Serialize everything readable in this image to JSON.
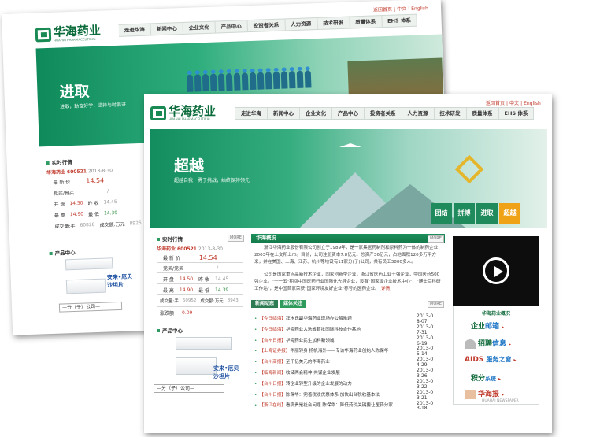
{
  "logo": {
    "name": "华海药业",
    "sub": "HUAHAI PHARMACEUTICAL"
  },
  "toplinks": [
    "返回首页",
    "中文",
    "English"
  ],
  "nav": [
    "走进华海",
    "新闻中心",
    "企业文化",
    "产品中心",
    "投资者关系",
    "人力资源",
    "技术研发",
    "质量体系",
    "EHS 体系"
  ],
  "back_banner": {
    "big": "进取",
    "sub": "进取，勤奋好学，坚持与时俱进"
  },
  "front_banner": {
    "big": "超越",
    "sub": "超越自我，勇于挑战，始终保持领先"
  },
  "banner_buttons": [
    {
      "label": "团结",
      "active": false
    },
    {
      "label": "拼搏",
      "active": false
    },
    {
      "label": "进取",
      "active": false
    },
    {
      "label": "超越",
      "active": true
    }
  ],
  "stock": {
    "title": "实时行情",
    "name": "华海药业",
    "code": "600521",
    "date": "2013-8-30",
    "latest_label": "最 新 价",
    "latest": "14.54",
    "bid_label": "竞买/竞买",
    "bid": "-/-",
    "open_label": "开 盘",
    "open": "14.50",
    "prev_label": "昨 收",
    "prev": "14.45",
    "high_label": "最 高",
    "high": "14.90",
    "low_label": "最 低",
    "low": "14.39",
    "vol_label": "成交量:手",
    "vol": "60952",
    "amt_label": "成交额:万元",
    "amt": "8943",
    "change_label": "涨跌额",
    "change": "0.09",
    "back_vol": "60828",
    "back_amt": "8925",
    "more": "MORE"
  },
  "products": {
    "title": "产品中心",
    "label1": "安来•厄贝",
    "label2": "沙坦片",
    "select": "—分（子）公司—"
  },
  "overview": {
    "title": "华海概况",
    "more": "MORE",
    "p1": "浙江华海药业股份有限公司创立于1989年，是一家集医药制剂和原料药为一体的制药企业，2003年在上交所上市。目前，公司注册资本7.8亿元，总资产36亿元，占地面积120多万平方米，并在美国、上海、江苏、杭州等地设有11家分(子)公司，共有员工3800多人。",
    "p2": "公司是国家重点高新技术企业，国家创新型企业，浙江省医药工业十强企业，中国医药500强企业。\"十一五\"期间中国医药行业国际化先导企业，设有\"国家级企业技术中心\"、\"博士后科研工作站\"，是中国首家荣获\"国家环境友好企业\"称号的医药企业。",
    "detail": "[详情]"
  },
  "news": {
    "tabs": [
      {
        "label": "新闻动态",
        "active": false
      },
      {
        "label": "媒体关注",
        "active": true
      }
    ],
    "more": "MORE",
    "items": [
      {
        "src": "【今日临海】",
        "text": "拜水氏副华海药业现场办公解难题",
        "date": "2013-08-07"
      },
      {
        "src": "【今日临海】",
        "text": "华海药业入选省首批国际科技合作基地",
        "date": "2013-07-31"
      },
      {
        "src": "【台州日报】",
        "text": "华海药业民生加料新领域",
        "date": "2013-06-19"
      },
      {
        "src": "【上海证券报】",
        "text": "华丽转身 扬帆海外——专访华海药业创始人陈保华",
        "date": "2013-05-14"
      },
      {
        "src": "【台州商报】",
        "text": "至千亿美元的华海药业",
        "date": "2013-04-29"
      },
      {
        "src": "【临海新闻】",
        "text": "收储两会精神 共谋企业发展",
        "date": "2013-03-26"
      },
      {
        "src": "【台州日报】",
        "text": "转企业转型升级的企业发展的动力",
        "date": "2013-03-22"
      },
      {
        "src": "【台州日报】",
        "text": "陈保华：完善税收优惠体系 加快出台税收基本法",
        "date": "2013-03-21"
      },
      {
        "src": "【浙江在线】",
        "text": "看病贵是社会问题 陈保华：降低药价关键要让医药分家",
        "date": "2013-03-18"
      }
    ]
  },
  "side": {
    "title": "华海药业概况",
    "items": [
      {
        "a": "企业",
        "b": "邮箱",
        "tiny": ""
      },
      {
        "a": "招聘",
        "b": "信息",
        "tiny": ""
      },
      {
        "a": "AIDS",
        "b": "服务之窗",
        "tiny": ""
      },
      {
        "a": "积分",
        "b": "系统",
        "tiny": ""
      },
      {
        "a": "华海",
        "b": "报",
        "tiny": "HUAHAI NEWSPAPER"
      }
    ]
  },
  "colors": {
    "green": "#1a8a55",
    "red": "#c0392b",
    "gold": "#f0a216"
  }
}
